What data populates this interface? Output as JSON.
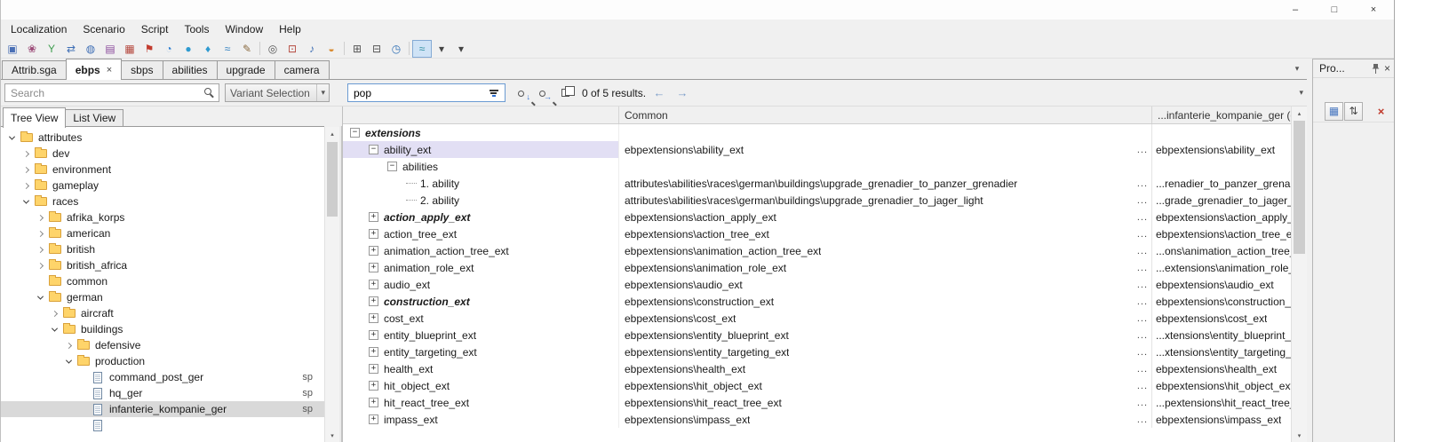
{
  "colors": {
    "row_selection": "#e2dff4",
    "tree_selection": "#d9d9d9",
    "toolbar_toggle_active": "#cfe3f6",
    "filter_input_border": "#6b9bd2"
  },
  "icons": {
    "combo_chevron": "▾",
    "tab_list": "▾",
    "search_panel": "▾",
    "scroll_up": "▴",
    "scroll_down": "▾",
    "results_prev": "←",
    "results_next": "→",
    "find_next_arrow": "↓",
    "find_all_arrow": "→",
    "close": "×"
  },
  "window": {
    "controls": [
      {
        "name": "minimize",
        "glyph": "–"
      },
      {
        "name": "maximize",
        "glyph": "□"
      },
      {
        "name": "close",
        "glyph": "×"
      }
    ]
  },
  "menu_bar": {
    "items": [
      "Localization",
      "Scenario",
      "Script",
      "Tools",
      "Window",
      "Help"
    ]
  },
  "toolbar": {
    "icons": [
      {
        "name": "layers-icon",
        "glyph": "▣",
        "color": "#4a6fb5"
      },
      {
        "name": "flower-icon",
        "glyph": "❀",
        "color": "#9c4a78"
      },
      {
        "name": "branch-icon",
        "glyph": "Y",
        "color": "#3f9e4f"
      },
      {
        "name": "transfer-icon",
        "glyph": "⇄",
        "color": "#3f6fb5"
      },
      {
        "name": "world-search-icon",
        "glyph": "◍",
        "color": "#3f6fb5"
      },
      {
        "name": "stamp-icon",
        "glyph": "▤",
        "color": "#8a4a9c"
      },
      {
        "name": "table-icon",
        "glyph": "▦",
        "color": "#b5493f"
      },
      {
        "name": "flag-icon",
        "glyph": "⚑",
        "color": "#c23b2e"
      },
      {
        "name": "globe-icon",
        "glyph": "◔",
        "color": "#2e7fd0"
      },
      {
        "name": "sphere-icon",
        "glyph": "●",
        "color": "#2e9ad0"
      },
      {
        "name": "droplet-icon",
        "glyph": "♦",
        "color": "#2e9ad0"
      },
      {
        "name": "waves-icon",
        "glyph": "≈",
        "color": "#2e7fc0"
      },
      {
        "name": "edit-icon",
        "glyph": "✎",
        "color": "#8a6a3f"
      },
      {
        "sep": true
      },
      {
        "name": "find-icon",
        "glyph": "◎",
        "color": "#555555"
      },
      {
        "name": "target-icon",
        "glyph": "⊡",
        "color": "#b5493f"
      },
      {
        "name": "audio-icon",
        "glyph": "♪",
        "color": "#3f6fb5"
      },
      {
        "name": "horizon-icon",
        "glyph": "◒",
        "color": "#d98a2e"
      },
      {
        "sep": true
      },
      {
        "name": "frame-icon",
        "glyph": "⊞",
        "color": "#555555"
      },
      {
        "name": "grid-icon",
        "glyph": "⊟",
        "color": "#555555"
      },
      {
        "name": "clock-icon",
        "glyph": "◷",
        "color": "#2e6fb5"
      },
      {
        "sep": true
      },
      {
        "name": "draw-toggle-icon",
        "glyph": "≈",
        "color": "#2e8fa0",
        "selected": true
      },
      {
        "name": "draw-options-chevron-icon",
        "glyph": "▾",
        "color": "#444444"
      },
      {
        "name": "toolbar-overflow-icon",
        "glyph": "▾",
        "color": "#444444"
      }
    ]
  },
  "tabs": {
    "close_glyph": "×",
    "items": [
      {
        "label": "Attrib.sga",
        "active": false,
        "closable": false
      },
      {
        "label": "ebps",
        "active": true,
        "closable": true
      },
      {
        "label": "sbps",
        "active": false,
        "closable": false
      },
      {
        "label": "abilities",
        "active": false,
        "closable": false
      },
      {
        "label": "upgrade",
        "active": false,
        "closable": false
      },
      {
        "label": "camera",
        "active": false,
        "closable": false
      }
    ]
  },
  "search_bar": {
    "search_placeholder": "Search",
    "variant_selection_label": "Variant Selection",
    "filter_value": "pop",
    "results_text": "0 of 5 results."
  },
  "left_panel": {
    "tabs": [
      {
        "label": "Tree View",
        "active": true
      },
      {
        "label": "List View",
        "active": false
      }
    ],
    "tree": [
      {
        "label": "attributes",
        "indent": 0,
        "kind": "folder",
        "state": "expanded"
      },
      {
        "label": "dev",
        "indent": 1,
        "kind": "folder",
        "state": "collapsed"
      },
      {
        "label": "environment",
        "indent": 1,
        "kind": "folder",
        "state": "collapsed"
      },
      {
        "label": "gameplay",
        "indent": 1,
        "kind": "folder",
        "state": "collapsed"
      },
      {
        "label": "races",
        "indent": 1,
        "kind": "folder",
        "state": "expanded"
      },
      {
        "label": "afrika_korps",
        "indent": 2,
        "kind": "folder",
        "state": "collapsed"
      },
      {
        "label": "american",
        "indent": 2,
        "kind": "folder",
        "state": "collapsed"
      },
      {
        "label": "british",
        "indent": 2,
        "kind": "folder",
        "state": "collapsed"
      },
      {
        "label": "british_africa",
        "indent": 2,
        "kind": "folder",
        "state": "collapsed"
      },
      {
        "label": "common",
        "indent": 2,
        "kind": "folder",
        "state": "none"
      },
      {
        "label": "german",
        "indent": 2,
        "kind": "folder",
        "state": "expanded"
      },
      {
        "label": "aircraft",
        "indent": 3,
        "kind": "folder",
        "state": "collapsed"
      },
      {
        "label": "buildings",
        "indent": 3,
        "kind": "folder",
        "state": "expanded"
      },
      {
        "label": "defensive",
        "indent": 4,
        "kind": "folder",
        "state": "collapsed"
      },
      {
        "label": "production",
        "indent": 4,
        "kind": "folder",
        "state": "expanded"
      },
      {
        "label": "command_post_ger",
        "indent": 5,
        "kind": "file",
        "state": "none",
        "tag": "sp"
      },
      {
        "label": "hq_ger",
        "indent": 5,
        "kind": "file",
        "state": "none",
        "tag": "sp"
      },
      {
        "label": "infanterie_kompanie_ger",
        "indent": 5,
        "kind": "file",
        "state": "none",
        "tag": "sp",
        "selected": true
      },
      {
        "label": "",
        "indent": 5,
        "kind": "file",
        "state": "none"
      }
    ]
  },
  "table": {
    "columns": [
      "",
      "Common",
      "...infanterie_kompanie_ger (de"
    ],
    "more_button_label": "...",
    "expander_glyphs": {
      "minus": "−",
      "plus": "+"
    },
    "rows": [
      {
        "label": "extensions",
        "indent": 0,
        "expander": "minus",
        "style": "bold-italic",
        "common": "",
        "value": "",
        "more": false
      },
      {
        "label": "ability_ext",
        "indent": 1,
        "expander": "minus",
        "common": "ebpextensions\\ability_ext",
        "value": "ebpextensions\\ability_ext",
        "more": true,
        "selected": true
      },
      {
        "label": "abilities",
        "indent": 2,
        "expander": "minus",
        "common": "",
        "value": "",
        "more": false
      },
      {
        "label": "1. ability",
        "indent": 3,
        "expander": "leaf",
        "common": "attributes\\abilities\\races\\german\\buildings\\upgrade_grenadier_to_panzer_grenadier",
        "value": "...renadier_to_panzer_grenadi",
        "more": true
      },
      {
        "label": "2. ability",
        "indent": 3,
        "expander": "leaf",
        "common": "attributes\\abilities\\races\\german\\buildings\\upgrade_grenadier_to_jager_light",
        "value": "...grade_grenadier_to_jager_lig",
        "more": true
      },
      {
        "label": "action_apply_ext",
        "indent": 1,
        "expander": "plus",
        "style": "bold-italic",
        "common": "ebpextensions\\action_apply_ext",
        "value": "ebpextensions\\action_apply_e",
        "more": true
      },
      {
        "label": "action_tree_ext",
        "indent": 1,
        "expander": "plus",
        "common": "ebpextensions\\action_tree_ext",
        "value": "ebpextensions\\action_tree_ext",
        "more": true
      },
      {
        "label": "animation_action_tree_ext",
        "indent": 1,
        "expander": "plus",
        "common": "ebpextensions\\animation_action_tree_ext",
        "value": "...ons\\animation_action_tree_e",
        "more": true
      },
      {
        "label": "animation_role_ext",
        "indent": 1,
        "expander": "plus",
        "common": "ebpextensions\\animation_role_ext",
        "value": "...extensions\\animation_role_e",
        "more": true
      },
      {
        "label": "audio_ext",
        "indent": 1,
        "expander": "plus",
        "common": "ebpextensions\\audio_ext",
        "value": "ebpextensions\\audio_ext",
        "more": true
      },
      {
        "label": "construction_ext",
        "indent": 1,
        "expander": "plus",
        "style": "bold-italic",
        "common": "ebpextensions\\construction_ext",
        "value": "ebpextensions\\construction_e",
        "more": true
      },
      {
        "label": "cost_ext",
        "indent": 1,
        "expander": "plus",
        "common": "ebpextensions\\cost_ext",
        "value": "ebpextensions\\cost_ext",
        "more": true
      },
      {
        "label": "entity_blueprint_ext",
        "indent": 1,
        "expander": "plus",
        "common": "ebpextensions\\entity_blueprint_ext",
        "value": "...xtensions\\entity_blueprint_e",
        "more": true
      },
      {
        "label": "entity_targeting_ext",
        "indent": 1,
        "expander": "plus",
        "common": "ebpextensions\\entity_targeting_ext",
        "value": "...xtensions\\entity_targeting_e",
        "more": true
      },
      {
        "label": "health_ext",
        "indent": 1,
        "expander": "plus",
        "common": "ebpextensions\\health_ext",
        "value": "ebpextensions\\health_ext",
        "more": true
      },
      {
        "label": "hit_object_ext",
        "indent": 1,
        "expander": "plus",
        "common": "ebpextensions\\hit_object_ext",
        "value": "ebpextensions\\hit_object_ext",
        "more": true
      },
      {
        "label": "hit_react_tree_ext",
        "indent": 1,
        "expander": "plus",
        "common": "ebpextensions\\hit_react_tree_ext",
        "value": "...pextensions\\hit_react_tree_e",
        "more": true
      },
      {
        "label": "impass_ext",
        "indent": 1,
        "expander": "plus",
        "common": "ebpextensions\\impass_ext",
        "value": "ebpextensions\\impass_ext",
        "more": true
      }
    ]
  },
  "properties_panel": {
    "title": "Pro...",
    "buttons": [
      {
        "name": "categorized-button",
        "glyph": "▦",
        "color": "#4a78c0"
      },
      {
        "name": "alphabetical-button",
        "glyph": "⇅",
        "color": "#444444"
      },
      {
        "name": "reset-button",
        "glyph": "×",
        "color": "#c0392b",
        "plain": true
      }
    ]
  }
}
